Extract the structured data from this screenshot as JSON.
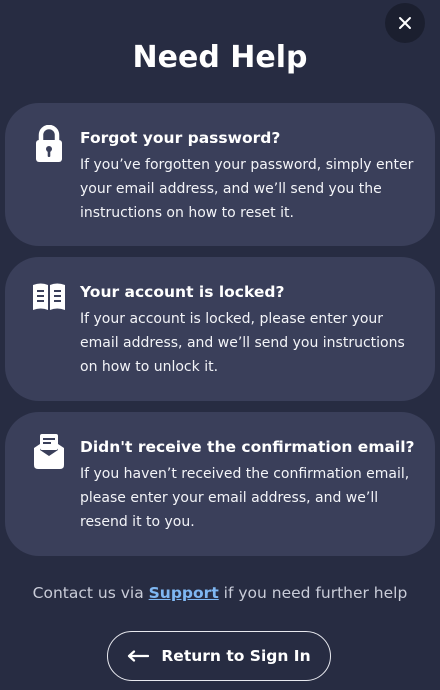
{
  "dialog": {
    "title": "Need Help",
    "close_icon": "close-icon"
  },
  "cards": [
    {
      "icon": "lock-icon",
      "title": "Forgot your password?",
      "description": "If you’ve forgotten your password, simply enter your email address, and we’ll send you the instructions on how to reset it."
    },
    {
      "icon": "book-icon",
      "title": "Your account is locked?",
      "description": "If your account is locked, please enter your email address, and we’ll send you instructions on how to unlock it."
    },
    {
      "icon": "mail-tray-icon",
      "title": "Didn't receive the confirmation email?",
      "description": "If you haven’t received the confirmation email, please enter your email address, and we’ll resend it to you."
    }
  ],
  "footer": {
    "contact_prefix": "Contact us via ",
    "support_link": "Support",
    "contact_suffix": " if you need further help",
    "return_button": "Return to Sign In",
    "return_icon": "arrow-left-icon"
  },
  "colors": {
    "background": "#272c42",
    "card": "#3a3f5a",
    "link": "#7fb7f2"
  }
}
